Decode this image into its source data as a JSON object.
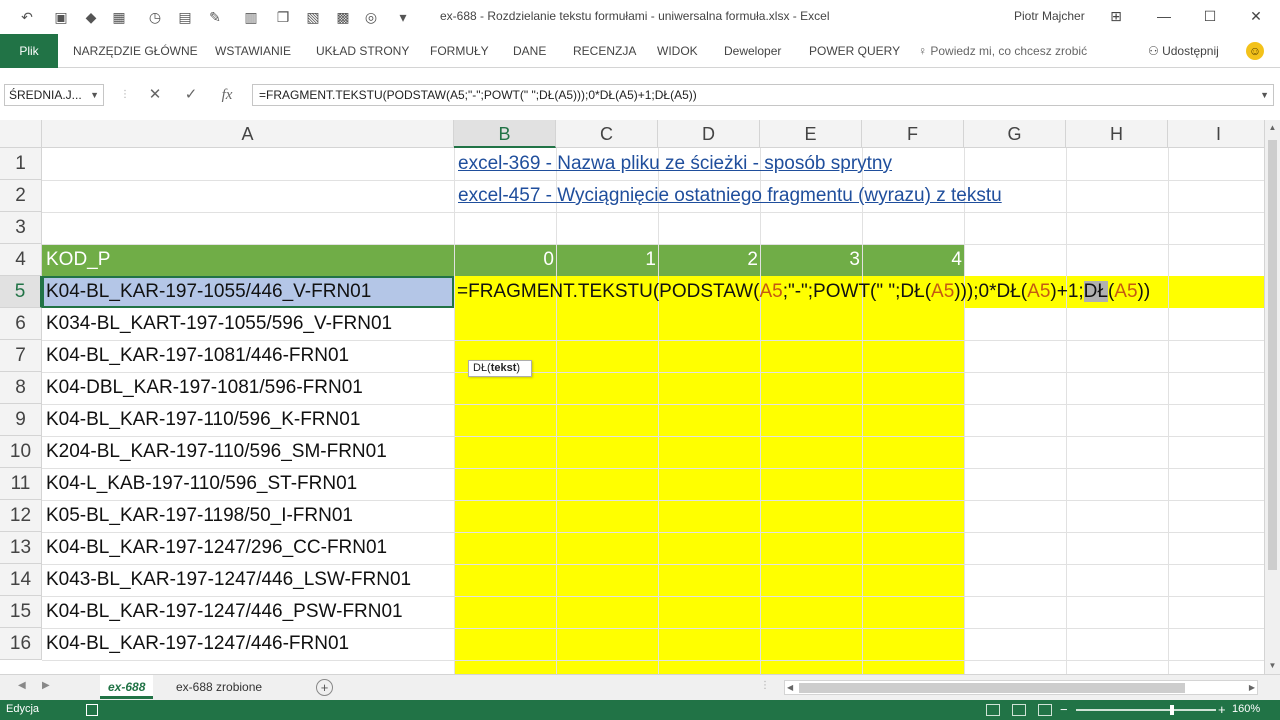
{
  "window": {
    "title": "ex-688 - Rozdzielanie tekstu formułami - uniwersalna formuła.xlsx  -  Excel",
    "user": "Piotr Majcher"
  },
  "ribbon": {
    "file": "Plik",
    "tabs": [
      "NARZĘDZIE GŁÓWNE",
      "WSTAWIANIE",
      "UKŁAD STRONY",
      "FORMUŁY",
      "DANE",
      "RECENZJA",
      "WIDOK",
      "Deweloper",
      "POWER QUERY"
    ],
    "tell_me": "Powiedz mi, co chcesz zrobić",
    "share": "Udostępnij"
  },
  "formula_bar": {
    "name_box": "ŚREDNIA.J...",
    "fx": "fx",
    "formula": "=FRAGMENT.TEKSTU(PODSTAW(A5;\"-\";POWT(\" \";DŁ(A5)));0*DŁ(A5)+1;DŁ(A5))"
  },
  "grid": {
    "columns": [
      "A",
      "B",
      "C",
      "D",
      "E",
      "F",
      "G",
      "H",
      "I"
    ],
    "rows": [
      "1",
      "2",
      "3",
      "4",
      "5",
      "6",
      "7",
      "8",
      "9",
      "10",
      "11",
      "12",
      "13",
      "14",
      "15",
      "16"
    ],
    "links": [
      "excel-369 - Nazwa pliku ze ścieżki - sposób sprytny",
      "excel-457 - Wyciągnięcie ostatniego fragmentu (wyrazu) z tekstu"
    ],
    "header_label": "KOD_P",
    "header_numbers": [
      "0",
      "1",
      "2",
      "3",
      "4"
    ],
    "codes": [
      "K04-BL_KAR-197-1055/446_V-FRN01",
      "K034-BL_KART-197-1055/596_V-FRN01",
      "K04-BL_KAR-197-1081/446-FRN01",
      "K04-DBL_KAR-197-1081/596-FRN01",
      "K04-BL_KAR-197-110/596_K-FRN01",
      "K204-BL_KAR-197-110/596_SM-FRN01",
      "K04-L_KAB-197-110/596_ST-FRN01",
      "K05-BL_KAR-197-1198/50_I-FRN01",
      "K04-BL_KAR-197-1247/296_CC-FRN01",
      "K043-BL_KAR-197-1247/446_LSW-FRN01",
      "K04-BL_KAR-197-1247/446_PSW-FRN01",
      "K04-BL_KAR-197-1247/446-FRN01"
    ],
    "edit_parts": [
      {
        "t": "=FRAGMENT.TEKSTU(PODSTAW(",
        "c": ""
      },
      {
        "t": "A5",
        "c": "ref"
      },
      {
        "t": ";\"-\";POWT(\" \";DŁ(",
        "c": ""
      },
      {
        "t": "A5",
        "c": "ref"
      },
      {
        "t": ")));0*DŁ(",
        "c": ""
      },
      {
        "t": "A5",
        "c": "ref"
      },
      {
        "t": ")+1;",
        "c": ""
      },
      {
        "t": "DŁ",
        "c": "hl"
      },
      {
        "t": "(",
        "c": ""
      },
      {
        "t": "A5",
        "c": "ref"
      },
      {
        "t": "))",
        "c": ""
      }
    ],
    "tooltip_fn": "DŁ(",
    "tooltip_arg": "tekst",
    "tooltip_end": ")"
  },
  "sheets": {
    "tabs": [
      "ex-688",
      "ex-688 zrobione"
    ],
    "active": 0
  },
  "status": {
    "mode": "Edycja",
    "zoom": "160%"
  },
  "colors": {
    "excel_green": "#217346",
    "header_green": "#70ad47",
    "highlight_yellow": "#ffff00",
    "selection_blue": "#b4c6e7",
    "ref_orange": "#c55a11",
    "link_blue": "#1f4e9c"
  }
}
